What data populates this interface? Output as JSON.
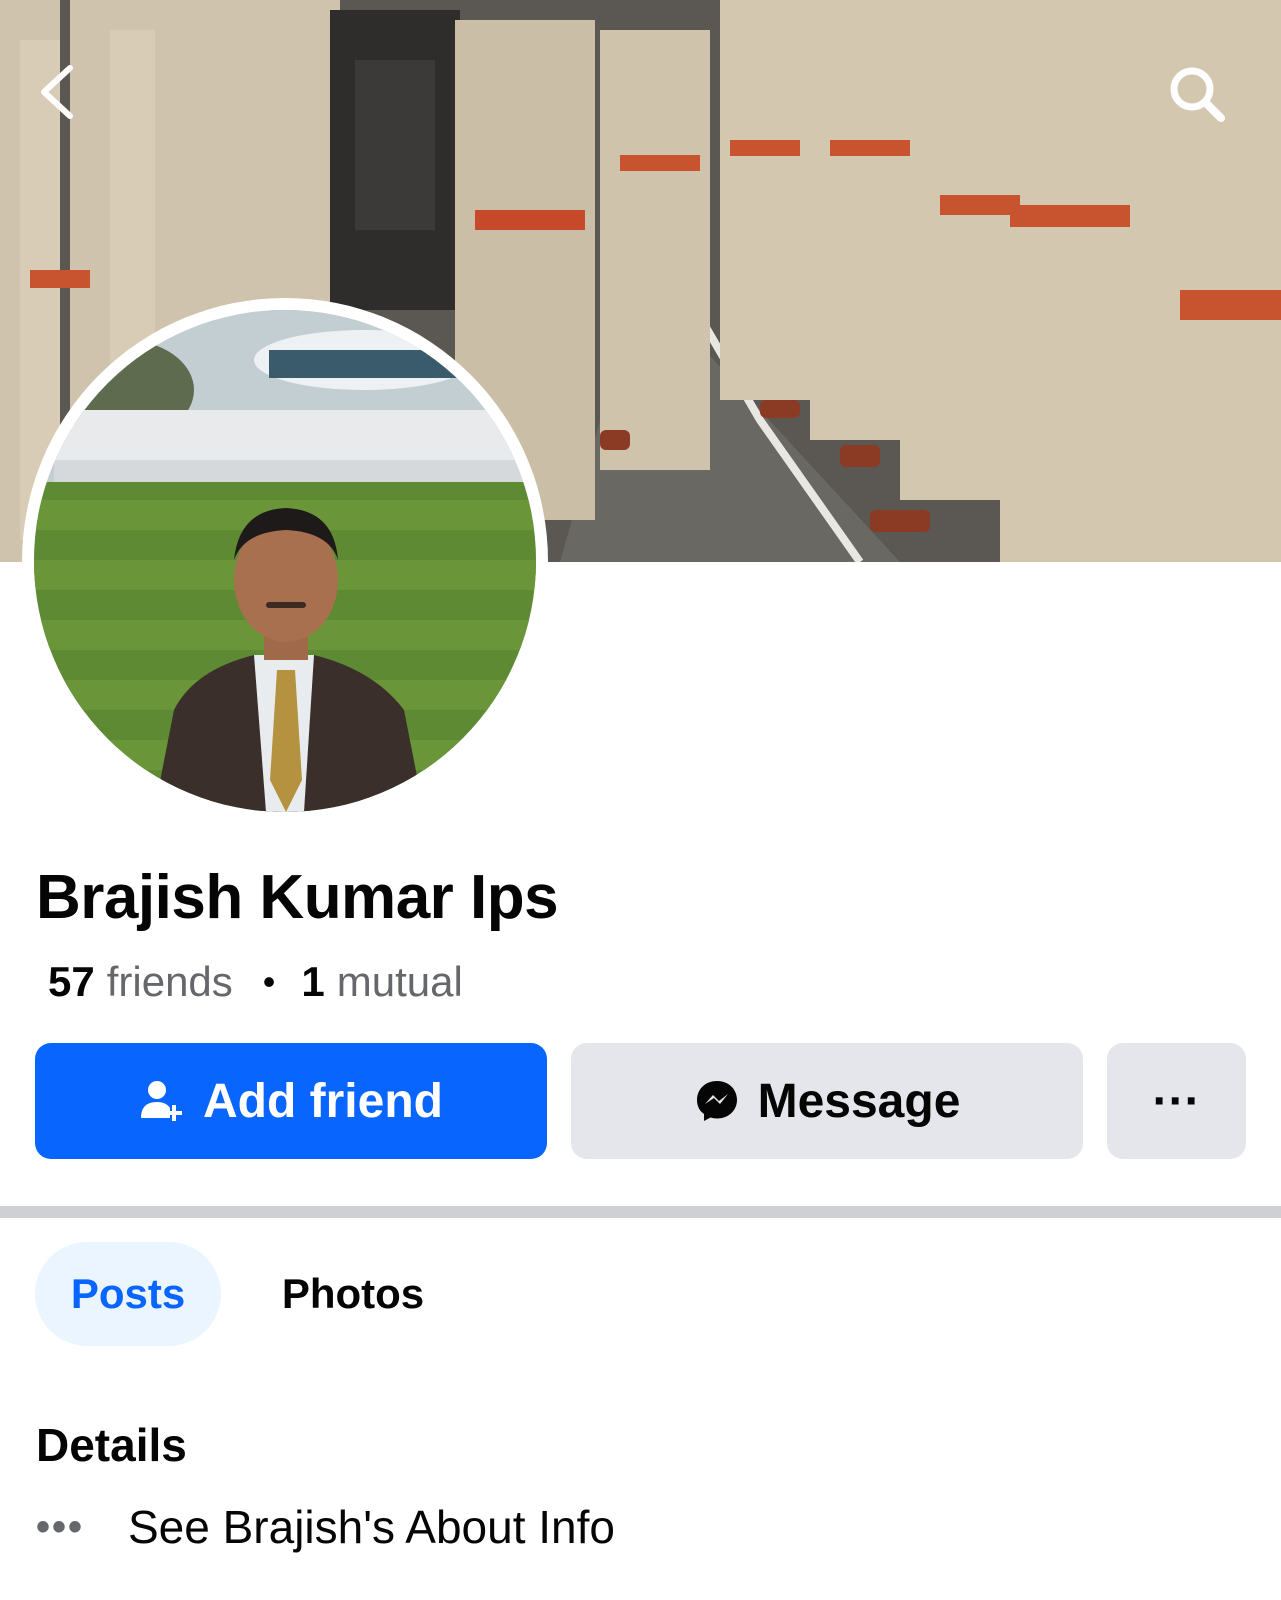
{
  "header": {
    "back_icon": "chevron-left-icon",
    "search_icon": "search-icon"
  },
  "profile": {
    "name": "Brajish Kumar Ips",
    "friends_count": "57",
    "friends_label": "friends",
    "mutual_count": "1",
    "mutual_label": "mutual",
    "separator": "•"
  },
  "actions": {
    "add_friend_label": "Add friend",
    "add_friend_icon": "person-add-icon",
    "message_label": "Message",
    "message_icon": "messenger-icon",
    "more_label": "···"
  },
  "tabs": [
    {
      "label": "Posts",
      "active": true
    },
    {
      "label": "Photos",
      "active": false
    }
  ],
  "details": {
    "title": "Details",
    "about_dots": "•••",
    "about_label": "See Brajish's About Info"
  },
  "colors": {
    "primary": "#0866ff",
    "secondary_button": "#e4e6eb",
    "tab_active_bg": "#ebf5ff",
    "divider": "#ced0d4",
    "muted_text": "#65676b"
  }
}
